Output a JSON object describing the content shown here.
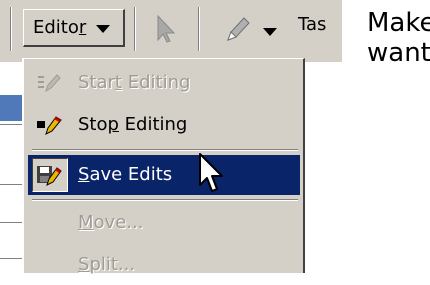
{
  "toolbar": {
    "editor_label_pre": "Edito",
    "editor_label_ul": "r",
    "task_label": "Tas"
  },
  "menu": {
    "items": [
      {
        "pre": "Star",
        "ul": "t",
        "post": " Editing",
        "state": "disabled",
        "icon": "start-editing-icon"
      },
      {
        "pre": "Sto",
        "ul": "p",
        "post": " Editing",
        "state": "enabled",
        "icon": "stop-editing-icon"
      },
      {
        "pre": "",
        "ul": "S",
        "post": "ave Edits",
        "state": "selected",
        "icon": "save-edits-icon"
      },
      {
        "pre": "",
        "ul": "M",
        "post": "ove...",
        "state": "disabled"
      },
      {
        "pre": "",
        "ul": "S",
        "post": "plit...",
        "state": "disabled"
      }
    ]
  },
  "side_text": {
    "line1": "Make",
    "line2": "want"
  },
  "colors": {
    "menu_bg": "#d4d0c8",
    "selection": "#0a246a",
    "disabled_text": "#a09c94"
  }
}
